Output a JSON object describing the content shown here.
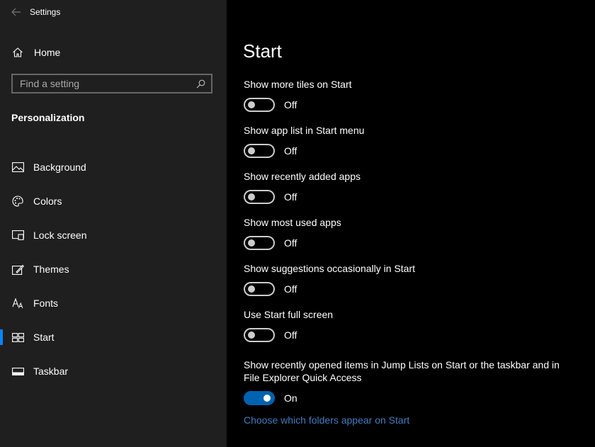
{
  "window": {
    "title": "Settings"
  },
  "sidebar": {
    "home_label": "Home",
    "search_placeholder": "Find a setting",
    "section": "Personalization",
    "items": [
      {
        "label": "Background",
        "icon": "image-icon"
      },
      {
        "label": "Colors",
        "icon": "palette-icon"
      },
      {
        "label": "Lock screen",
        "icon": "lock-screen-icon"
      },
      {
        "label": "Themes",
        "icon": "themes-icon"
      },
      {
        "label": "Fonts",
        "icon": "fonts-icon"
      },
      {
        "label": "Start",
        "icon": "start-icon",
        "active": true
      },
      {
        "label": "Taskbar",
        "icon": "taskbar-icon"
      }
    ]
  },
  "main": {
    "title": "Start",
    "settings": [
      {
        "label": "Show more tiles on Start",
        "state": "Off"
      },
      {
        "label": "Show app list in Start menu",
        "state": "Off"
      },
      {
        "label": "Show recently added apps",
        "state": "Off"
      },
      {
        "label": "Show most used apps",
        "state": "Off"
      },
      {
        "label": "Show suggestions occasionally in Start",
        "state": "Off"
      },
      {
        "label": "Use Start full screen",
        "state": "Off"
      },
      {
        "label": "Show recently opened items in Jump Lists on Start or the taskbar and in File Explorer Quick Access",
        "state": "On"
      }
    ],
    "link": "Choose which folders appear on Start"
  },
  "colors": {
    "sidebar_bg": "#1f1f1f",
    "main_bg": "#000000",
    "accent": "#0063b1",
    "link": "#3e7dc4"
  }
}
